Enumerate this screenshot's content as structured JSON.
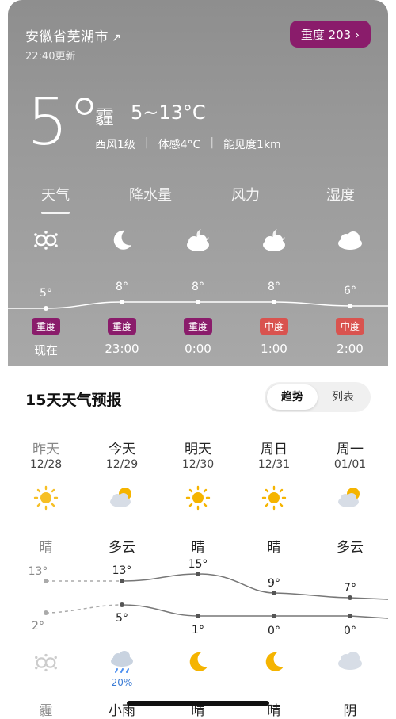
{
  "header": {
    "location": "安徽省芜湖市",
    "location_arrow": "↗",
    "updated": "22:40更新",
    "aqi_label": "重度 203 ›"
  },
  "current": {
    "temp": "5°",
    "condition": "霾",
    "range": "5~13°C",
    "wind": "西风1级",
    "feels": "体感4°C",
    "visibility": "能见度1km",
    "sep": "|"
  },
  "tabs": [
    "天气",
    "降水量",
    "风力",
    "湿度"
  ],
  "hourly": [
    {
      "icon": "haze-icon",
      "temp": "5°",
      "aqi": "重度",
      "aqi_level": "severe",
      "time": "现在"
    },
    {
      "icon": "moon-icon",
      "temp": "8°",
      "aqi": "重度",
      "aqi_level": "severe",
      "time": "23:00"
    },
    {
      "icon": "cloudy-night-icon",
      "temp": "8°",
      "aqi": "重度",
      "aqi_level": "severe",
      "time": "0:00"
    },
    {
      "icon": "cloudy-night-icon",
      "temp": "8°",
      "aqi": "中度",
      "aqi_level": "moderate",
      "time": "1:00"
    },
    {
      "icon": "cloud-icon",
      "temp": "6°",
      "aqi": "中度",
      "aqi_level": "moderate",
      "time": "2:00"
    }
  ],
  "forecast": {
    "title": "15天天气预报",
    "toggle": [
      "趋势",
      "列表"
    ],
    "days": [
      {
        "name": "昨天",
        "date": "12/28",
        "icon": "sun-icon",
        "cond": "晴",
        "hi": "13°",
        "lo": "2°",
        "night_icon": "haze-icon",
        "precip": "",
        "night_cond": "霾"
      },
      {
        "name": "今天",
        "date": "12/29",
        "icon": "partly-cloudy-icon",
        "cond": "多云",
        "hi": "13°",
        "lo": "5°",
        "night_icon": "light-rain-icon",
        "precip": "20%",
        "night_cond": "小雨"
      },
      {
        "name": "明天",
        "date": "12/30",
        "icon": "sun-icon",
        "cond": "晴",
        "hi": "15°",
        "lo": "1°",
        "night_icon": "moon-icon",
        "precip": "",
        "night_cond": "晴"
      },
      {
        "name": "周日",
        "date": "12/31",
        "icon": "sun-icon",
        "cond": "晴",
        "hi": "9°",
        "lo": "0°",
        "night_icon": "moon-icon",
        "precip": "",
        "night_cond": "晴"
      },
      {
        "name": "周一",
        "date": "01/01",
        "icon": "partly-cloudy-icon",
        "cond": "多云",
        "hi": "7°",
        "lo": "0°",
        "night_icon": "cloud-icon",
        "precip": "",
        "night_cond": "阴"
      }
    ]
  },
  "colors": {
    "aqi_severe": "#8a1c6b",
    "aqi_moderate": "#d9534f",
    "sun": "#f5b400"
  }
}
